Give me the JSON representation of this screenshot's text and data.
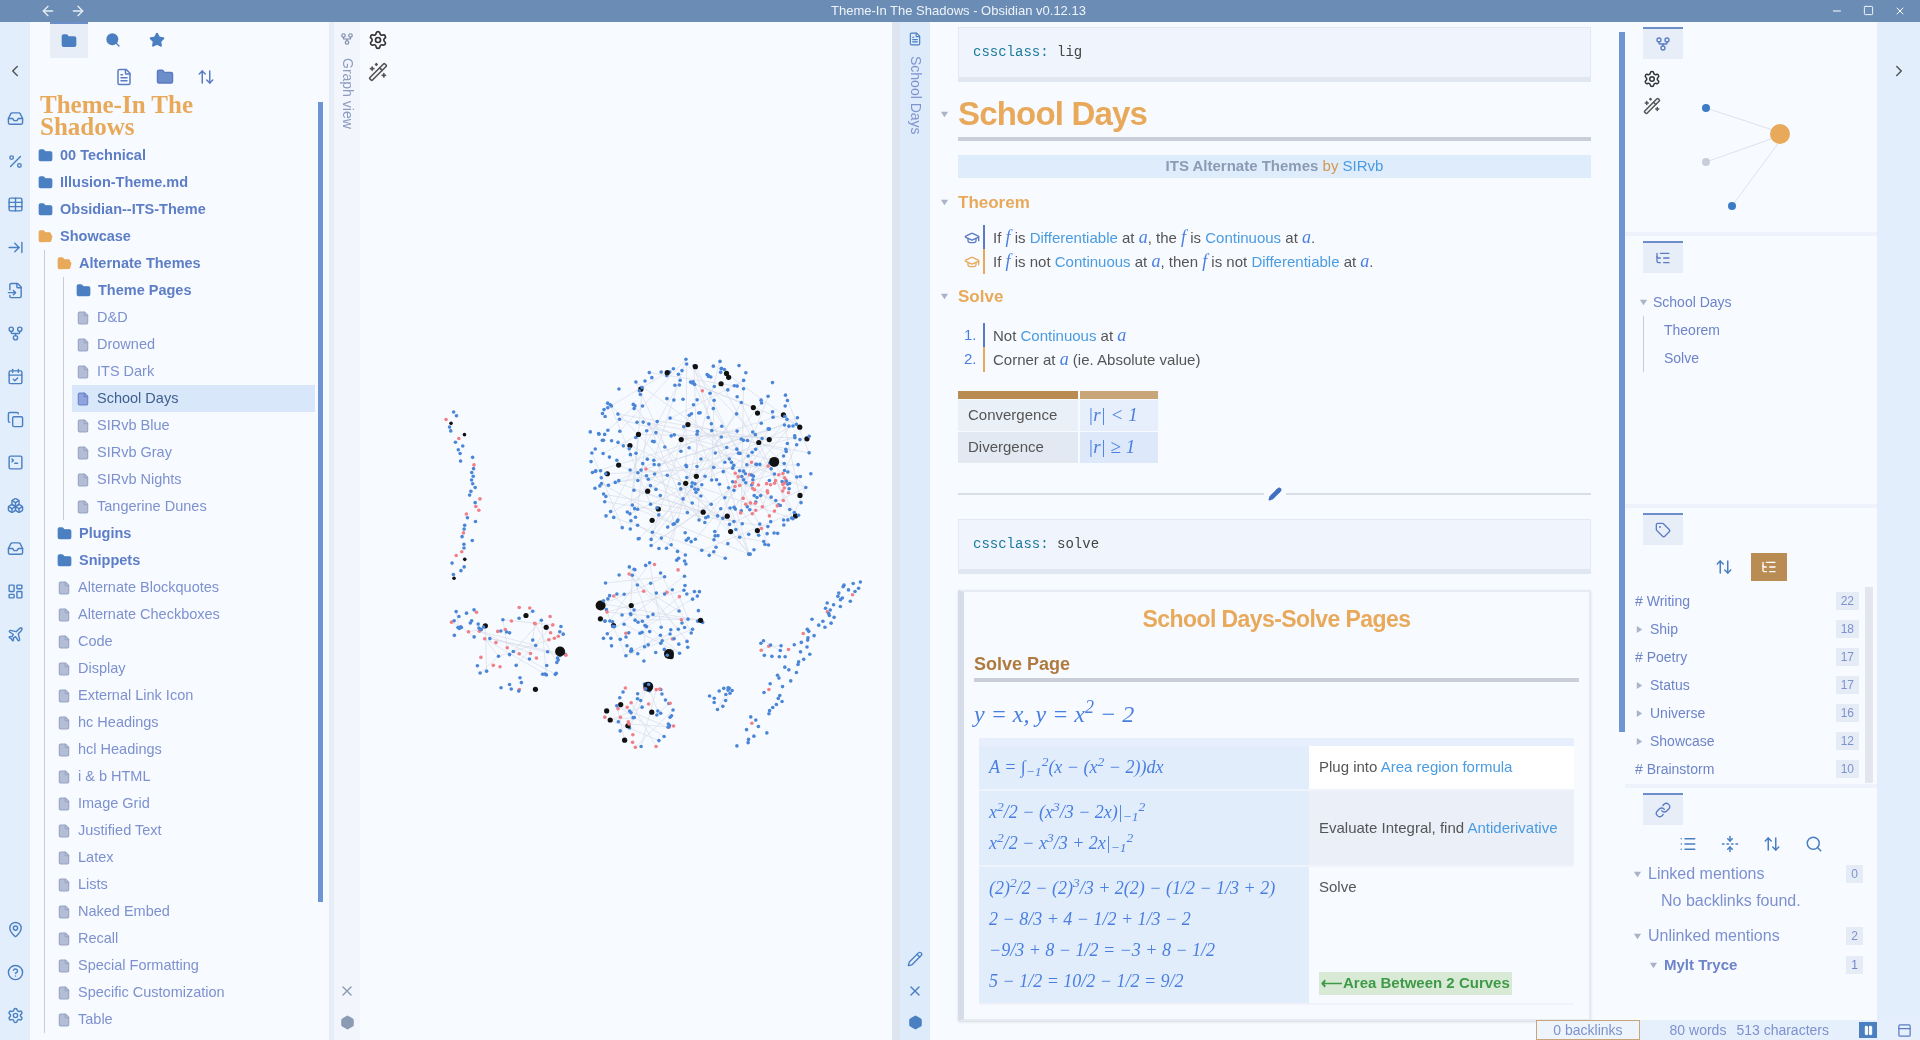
{
  "window": {
    "title": "Theme-In The Shadows - Obsidian v0.12.13"
  },
  "explorer": {
    "tabs": [
      {
        "kind": "files",
        "selected": true
      },
      {
        "kind": "search",
        "selected": false
      },
      {
        "kind": "starred",
        "selected": false
      }
    ],
    "vault_title": "Theme-In The Shadows",
    "tree": [
      {
        "kind": "folder",
        "label": "00 Technical",
        "expanded": false,
        "selected": false
      },
      {
        "kind": "folder",
        "label": "Illusion-Theme.md",
        "expanded": false,
        "selected": false
      },
      {
        "kind": "folder",
        "label": "Obsidian--ITS-Theme",
        "expanded": false,
        "selected": false
      },
      {
        "kind": "folder",
        "label": "Showcase",
        "expanded": true,
        "selected": false,
        "children": [
          {
            "kind": "folder",
            "label": "Alternate Themes",
            "expanded": true,
            "selected": false,
            "children": [
              {
                "kind": "folder",
                "label": "Theme Pages",
                "expanded": false,
                "selected": false
              },
              {
                "kind": "file",
                "label": "D&D",
                "selected": false
              },
              {
                "kind": "file",
                "label": "Drowned",
                "selected": false
              },
              {
                "kind": "file",
                "label": "ITS Dark",
                "selected": false
              },
              {
                "kind": "file",
                "label": "School Days",
                "selected": true
              },
              {
                "kind": "file",
                "label": "SIRvb Blue",
                "selected": false
              },
              {
                "kind": "file",
                "label": "SIRvb Gray",
                "selected": false
              },
              {
                "kind": "file",
                "label": "SIRvb Nights",
                "selected": false
              },
              {
                "kind": "file",
                "label": "Tangerine Dunes",
                "selected": false
              }
            ]
          },
          {
            "kind": "folder",
            "label": "Plugins",
            "expanded": false,
            "selected": false
          },
          {
            "kind": "folder",
            "label": "Snippets",
            "expanded": false,
            "selected": false
          },
          {
            "kind": "file",
            "label": "Alternate Blockquotes",
            "selected": false
          },
          {
            "kind": "file",
            "label": "Alternate Checkboxes",
            "selected": false
          },
          {
            "kind": "file",
            "label": "Code",
            "selected": false
          },
          {
            "kind": "file",
            "label": "Display",
            "selected": false
          },
          {
            "kind": "file",
            "label": "External Link Icon",
            "selected": false
          },
          {
            "kind": "file",
            "label": "hc Headings",
            "selected": false
          },
          {
            "kind": "file",
            "label": "hcl Headings",
            "selected": false
          },
          {
            "kind": "file",
            "label": "i & b HTML",
            "selected": false
          },
          {
            "kind": "file",
            "label": "Image Grid",
            "selected": false
          },
          {
            "kind": "file",
            "label": "Justified Text",
            "selected": false
          },
          {
            "kind": "file",
            "label": "Latex",
            "selected": false
          },
          {
            "kind": "file",
            "label": "Lists",
            "selected": false
          },
          {
            "kind": "file",
            "label": "Naked Embed",
            "selected": false
          },
          {
            "kind": "file",
            "label": "Recall",
            "selected": false
          },
          {
            "kind": "file",
            "label": "Special Formatting",
            "selected": false
          },
          {
            "kind": "file",
            "label": "Specific Customization",
            "selected": false
          },
          {
            "kind": "file",
            "label": "Table",
            "selected": false
          }
        ]
      }
    ]
  },
  "graph_view": {
    "tab_label": "Graph view"
  },
  "editor": {
    "tab_label": "School Days",
    "frontmatter": {
      "key": "cssclass:",
      "value": "lig"
    },
    "title": "School Days",
    "banner": [
      {
        "kind": "strong",
        "text": "ITS Alternate Themes"
      },
      {
        "kind": "by",
        "text": " by "
      },
      {
        "kind": "link",
        "text": "SIRvb"
      }
    ],
    "theorem": {
      "heading": "Theorem",
      "lines": [
        {
          "color": "#5b7bc4",
          "segments": [
            {
              "kind": "text",
              "text": "If "
            },
            {
              "kind": "math",
              "text": "f"
            },
            {
              "kind": "text",
              "text": " is "
            },
            {
              "kind": "link",
              "text": "Differentiable"
            },
            {
              "kind": "text",
              "text": " at "
            },
            {
              "kind": "math",
              "text": "a"
            },
            {
              "kind": "text",
              "text": ", the "
            },
            {
              "kind": "math",
              "text": "f"
            },
            {
              "kind": "text",
              "text": " is "
            },
            {
              "kind": "link",
              "text": "Continuous"
            },
            {
              "kind": "text",
              "text": " at "
            },
            {
              "kind": "math",
              "text": "a"
            },
            {
              "kind": "text",
              "text": "."
            }
          ]
        },
        {
          "color": "#e8a95b",
          "segments": [
            {
              "kind": "text",
              "text": "If "
            },
            {
              "kind": "math",
              "text": "f"
            },
            {
              "kind": "text",
              "text": " is not "
            },
            {
              "kind": "link",
              "text": "Continuous"
            },
            {
              "kind": "text",
              "text": " at "
            },
            {
              "kind": "math",
              "text": "a"
            },
            {
              "kind": "text",
              "text": ", then "
            },
            {
              "kind": "math",
              "text": "f"
            },
            {
              "kind": "text",
              "text": " is not "
            },
            {
              "kind": "link",
              "text": "Differentiable"
            },
            {
              "kind": "text",
              "text": " at "
            },
            {
              "kind": "math",
              "text": "a"
            },
            {
              "kind": "text",
              "text": "."
            }
          ]
        }
      ]
    },
    "solve": {
      "heading": "Solve",
      "items": [
        {
          "number": "1.",
          "color": "#5b7bc4",
          "segments": [
            {
              "kind": "text",
              "text": "Not "
            },
            {
              "kind": "link",
              "text": "Continuous"
            },
            {
              "kind": "text",
              "text": " at "
            },
            {
              "kind": "math",
              "text": "a"
            }
          ]
        },
        {
          "number": "2.",
          "color": "#e8a95b",
          "segments": [
            {
              "kind": "text",
              "text": "Corner at "
            },
            {
              "kind": "math",
              "text": "a"
            },
            {
              "kind": "text",
              "text": " (ie. Absolute value)"
            }
          ]
        }
      ]
    },
    "table": {
      "rows": [
        {
          "label": "Convergence",
          "math": "|r| < 1"
        },
        {
          "label": "Divergence",
          "math": "|r| ≥ 1"
        }
      ]
    },
    "frontmatter_2": {
      "key": "cssclass:",
      "value": "solve"
    },
    "embed": {
      "title": "School Days-Solve Pages",
      "heading": "Solve Page",
      "equation": "y = x, y = x$^{2}$ − 2",
      "rows": [
        {
          "math_lines": [
            "A = ∫$_{−1}$$^{2}$(x − (x$^{2}$ − 2))dx"
          ],
          "note": [
            {
              "kind": "text",
              "text": "Plug into "
            },
            {
              "kind": "link",
              "text": "Area region formula"
            }
          ]
        },
        {
          "math_lines": [
            "x$^{2}$/2 − (x$^{3}$/3 − 2x)|$_{−1}$$^{2}$",
            "x$^{2}$/2 − x$^{3}$/3 + 2x|$_{−1}$$^{2}$"
          ],
          "note": [
            {
              "kind": "text",
              "text": "Evaluate Integral, find "
            },
            {
              "kind": "link",
              "text": "Antiderivative"
            }
          ]
        },
        {
          "math_lines": [
            "(2)$^{2}$/2 − (2)$^{3}$/3 + 2(2) − (1/2 − 1/3 + 2)",
            "2 − 8/3 + 4 − 1/2 + 1/3 − 2",
            "−9/3 + 8 − 1/2 = −3 + 8 − 1/2",
            "5 − 1/2 = 10/2 − 1/2 = 9/2"
          ],
          "note": [
            {
              "kind": "text",
              "text": "Solve"
            }
          ],
          "callout": "⟵Area Between 2 Curves"
        }
      ]
    }
  },
  "outline": {
    "items": [
      {
        "text": "School Days",
        "expanded": true,
        "children": [
          {
            "text": "Theorem"
          },
          {
            "text": "Solve"
          }
        ]
      }
    ]
  },
  "tags": {
    "tree_view": true,
    "items": [
      {
        "kind": "tag",
        "label": "# Writing",
        "count": "22"
      },
      {
        "kind": "group",
        "label": "Ship",
        "count": "18"
      },
      {
        "kind": "tag",
        "label": "# Poetry",
        "count": "17"
      },
      {
        "kind": "group",
        "label": "Status",
        "count": "17"
      },
      {
        "kind": "group",
        "label": "Universe",
        "count": "16"
      },
      {
        "kind": "group",
        "label": "Showcase",
        "count": "12"
      },
      {
        "kind": "tag",
        "label": "# Brainstorm",
        "count": "10"
      }
    ]
  },
  "backlinks": {
    "sections": [
      {
        "title": "Linked mentions",
        "count": "0",
        "expanded": true,
        "empty_text": "No backlinks found."
      },
      {
        "title": "Unlinked mentions",
        "count": "2",
        "expanded": true,
        "files": [
          {
            "title": "Mylt Tryce",
            "count": "1",
            "expanded": true
          }
        ]
      }
    ]
  },
  "status_bar": {
    "backlinks": "0 backlinks",
    "words": "80 words",
    "characters": "513 characters"
  }
}
